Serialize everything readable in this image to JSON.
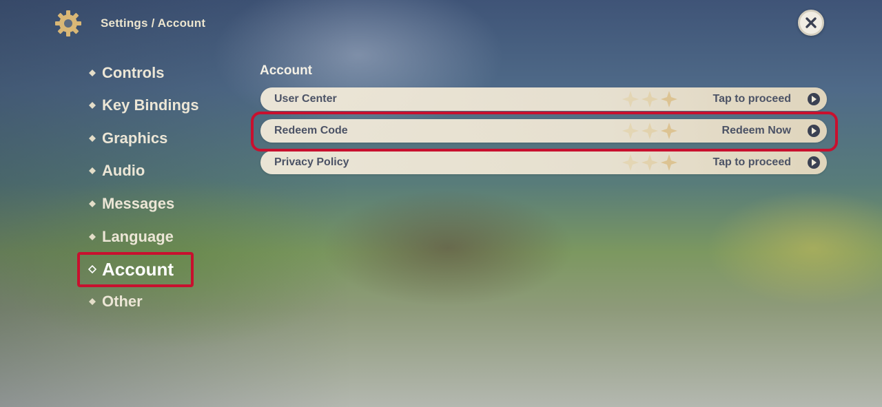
{
  "header": {
    "breadcrumb": "Settings / Account",
    "settings_icon": "gear-icon",
    "close_icon": "close-icon"
  },
  "sidebar": {
    "items": [
      {
        "label": "Controls",
        "active": false
      },
      {
        "label": "Key Bindings",
        "active": false
      },
      {
        "label": "Graphics",
        "active": false
      },
      {
        "label": "Audio",
        "active": false
      },
      {
        "label": "Messages",
        "active": false
      },
      {
        "label": "Language",
        "active": false
      },
      {
        "label": "Account",
        "active": true
      },
      {
        "label": "Other",
        "active": false
      }
    ]
  },
  "main": {
    "section_title": "Account",
    "rows": [
      {
        "label": "User Center",
        "action": "Tap to proceed",
        "highlighted": false
      },
      {
        "label": "Redeem Code",
        "action": "Redeem Now",
        "highlighted": true
      },
      {
        "label": "Privacy Policy",
        "action": "Tap to proceed",
        "highlighted": false
      }
    ]
  },
  "colors": {
    "highlight": "#c8102e",
    "gear": "#d9b776",
    "row_bg": "#efe8d8",
    "row_text": "#4b5265",
    "nav_text": "#ece6d6"
  }
}
